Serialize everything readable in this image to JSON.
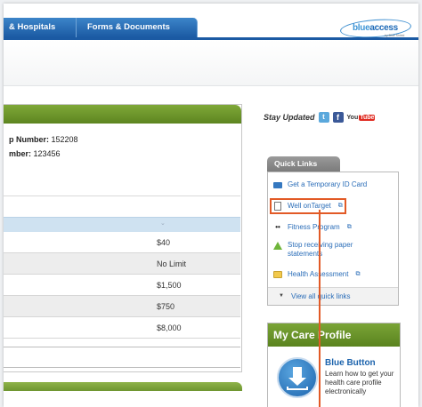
{
  "nav": {
    "tabs": [
      {
        "label": "& Hospitals"
      },
      {
        "label": "Forms & Documents"
      }
    ]
  },
  "logo": {
    "part1": "blue",
    "part2": "access",
    "subtext": "by Blue Shield"
  },
  "member_info": {
    "line1_label": "p Number:",
    "line1_value": "152208",
    "line2_label": "mber:",
    "line2_value": "123456"
  },
  "benefits": {
    "values": [
      "$40",
      "No Limit",
      "$1,500",
      "$750",
      "$8,000"
    ]
  },
  "stay_updated": {
    "label": "Stay Updated",
    "twitter_glyph": "t",
    "facebook_glyph": "f",
    "youtube_you": "You",
    "youtube_tube": "Tube"
  },
  "quick_links": {
    "title": "Quick Links",
    "items": [
      {
        "label": "Get a Temporary ID Card",
        "icon": "id-card-icon"
      },
      {
        "label": "Well onTarget",
        "icon": "document-icon",
        "external": true
      },
      {
        "label": "Fitness Program",
        "icon": "weights-icon",
        "external": true
      },
      {
        "label": "Stop receiving paper statements",
        "icon": "tree-icon"
      },
      {
        "label": "Health Assessment",
        "icon": "folder-icon",
        "external": true
      }
    ],
    "external_glyph": "⧉",
    "view_all": "View all quick links"
  },
  "care_profile": {
    "title": "My Care Profile",
    "blue_button_title": "Blue Button",
    "blue_button_desc": "Learn how to get your health care profile electronically"
  },
  "colors": {
    "nav_blue": "#1b5aa3",
    "panel_green": "#6e9530",
    "link_blue": "#2a6db8",
    "highlight_orange": "#e25a26"
  }
}
